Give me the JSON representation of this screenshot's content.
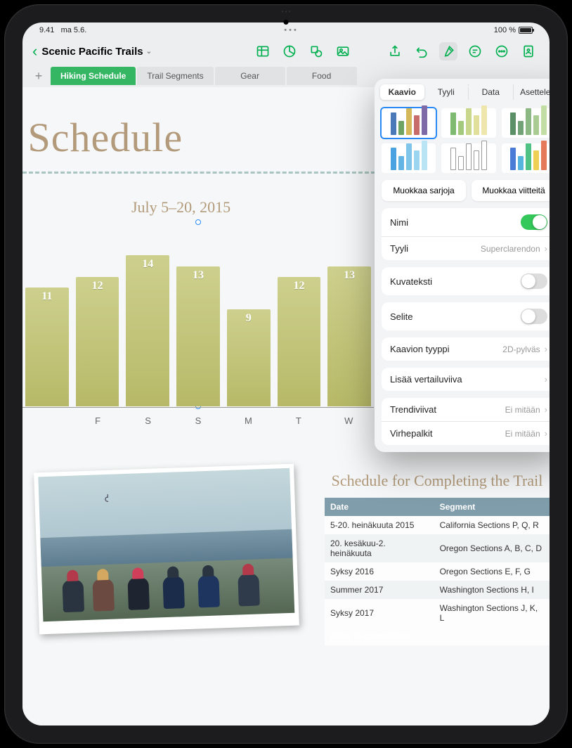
{
  "status": {
    "time": "9.41",
    "date": "ma 5.6.",
    "battery": "100 %"
  },
  "header": {
    "docTitle": "Scenic Pacific Trails",
    "icons": [
      "table",
      "pie",
      "shapes",
      "media",
      "share",
      "undo",
      "brush",
      "comment",
      "more",
      "collab"
    ]
  },
  "tabs": {
    "items": [
      "Hiking Schedule",
      "Trail Segments",
      "Gear",
      "Food"
    ],
    "activeIndex": 0
  },
  "document": {
    "bigTitle": "g Schedule",
    "chartTitle": "July 5–20, 2015"
  },
  "chart_data": {
    "type": "bar",
    "title": "July 5–20, 2015",
    "categories": [
      "",
      "F",
      "S",
      "S",
      "M",
      "T",
      "W"
    ],
    "values": [
      11,
      12,
      14,
      13,
      9,
      12,
      13
    ],
    "ylim": [
      0,
      15
    ],
    "xlabel": "",
    "ylabel": ""
  },
  "scheduleTable": {
    "title": "Schedule for Completing the Trail",
    "headers": [
      "Date",
      "Segment"
    ],
    "rows": [
      {
        "date": "5-20. heinäkuuta 2015",
        "segment": "California Sections P, Q, R"
      },
      {
        "date": "20. kesäkuu-2. heinäkuuta",
        "segment": "Oregon Sections A, B, C, D"
      },
      {
        "date": "Syksy 2016",
        "segment": "Oregon Sections E, F, G"
      },
      {
        "date": "Summer 2017",
        "segment": "Washington Sections H, I"
      },
      {
        "date": "Syksy 2017",
        "segment": "Washington Sections J, K, L"
      }
    ],
    "footer": "Miles to Completion"
  },
  "popover": {
    "tabs": [
      "Kaavio",
      "Tyyli",
      "Data",
      "Asettele"
    ],
    "activeTab": 0,
    "buttons": {
      "editSeries": "Muokkaa sarjoja",
      "editRefs": "Muokkaa viitteitä"
    },
    "thumbColors": [
      [
        "#4a7bb8",
        "#6fa364",
        "#d5b85a",
        "#c76b6b",
        "#7f6aa8"
      ],
      [
        "#7fba71",
        "#a3c97c",
        "#c7d78b",
        "#e0df9b",
        "#eee6ac"
      ],
      [
        "#5a8f68",
        "#72a376",
        "#8cb883",
        "#a8cc93",
        "#c3dea5"
      ],
      [
        "#4aa3e0",
        "#62b4e5",
        "#7fc5ea",
        "#9cd5ef",
        "#b9e4f4"
      ],
      [
        "#d0d0d0",
        "#d0d0d0",
        "#d0d0d0",
        "#d0d0d0",
        "#d0d0d0"
      ],
      [
        "#4a7bd6",
        "#55b5de",
        "#4fc285",
        "#eed055",
        "#e47a5a"
      ]
    ],
    "rows": {
      "name": {
        "label": "Nimi",
        "on": true
      },
      "style": {
        "label": "Tyyli",
        "value": "Superclarendon"
      },
      "caption": {
        "label": "Kuvateksti",
        "on": false
      },
      "legend": {
        "label": "Selite",
        "on": false
      },
      "chartType": {
        "label": "Kaavion tyyppi",
        "value": "2D-pylväs"
      },
      "refline": {
        "label": "Lisää vertailuviiva"
      },
      "trendlines": {
        "label": "Trendiviivat",
        "value": "Ei mitään"
      },
      "errorbars": {
        "label": "Virhepalkit",
        "value": "Ei mitään"
      }
    }
  }
}
